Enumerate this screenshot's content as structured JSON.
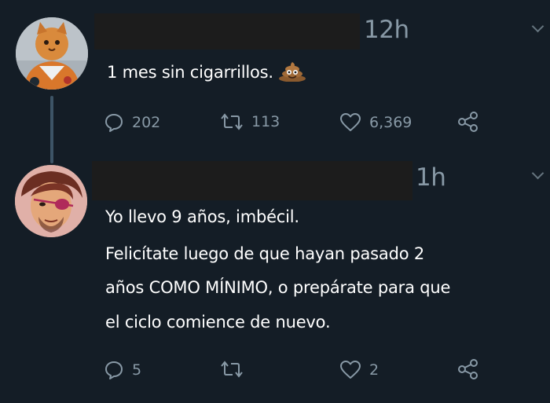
{
  "tweets": [
    {
      "avatar_icon": "astronaut-cat-avatar",
      "timestamp": "12h",
      "text": "1 mes sin cigarrillos.",
      "emoji_icon": "poop-emoji-icon",
      "actions": {
        "replies": "202",
        "retweets": "113",
        "likes": "6,369"
      }
    },
    {
      "avatar_icon": "illustrated-face-avatar",
      "timestamp": "1h",
      "text_lines": [
        "Yo llevo 9 años, imbécil.",
        "Felicítate luego de que hayan pasado 2",
        "años COMO MÍNIMO, o prepárate para que",
        "el ciclo comience de nuevo."
      ],
      "actions": {
        "replies": "5",
        "retweets": "",
        "likes": "2"
      }
    }
  ],
  "colors": {
    "background": "#141d26",
    "text": "#ffffff",
    "muted": "#8899a6",
    "thread_line": "#3d5466"
  }
}
